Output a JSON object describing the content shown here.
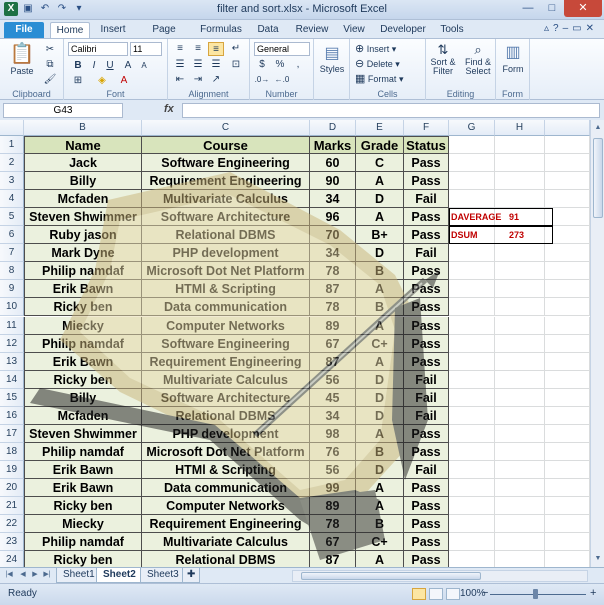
{
  "window": {
    "title": "filter and sort.xlsx  -  Microsoft Excel"
  },
  "ribbon": {
    "tabs": [
      "File",
      "Home",
      "Insert",
      "Page Layout",
      "Formulas",
      "Data",
      "Review",
      "View",
      "Developer",
      "Tools"
    ],
    "active_tab": "Home",
    "clipboard": {
      "paste": "Paste",
      "label": "Clipboard"
    },
    "font": {
      "name": "Calibri",
      "size": "11",
      "label": "Font"
    },
    "alignment": {
      "label": "Alignment"
    },
    "number": {
      "format": "General",
      "currency": "$",
      "percent": "%",
      "comma": ",",
      "label": "Number"
    },
    "styles": {
      "button": "Styles"
    },
    "cells": {
      "insert": "Insert",
      "delete": "Delete",
      "format": "Format",
      "label": "Cells"
    },
    "editing": {
      "sort": "Sort &",
      "sort2": "Filter",
      "find": "Find &",
      "find2": "Select",
      "label": "Editing"
    },
    "form": {
      "button": "Form",
      "label": "Form"
    }
  },
  "formula_bar": {
    "name_box": "G43",
    "fx": "fx",
    "value": ""
  },
  "columns": [
    "B",
    "C",
    "D",
    "E",
    "F",
    "G",
    "H"
  ],
  "rows": [
    "1",
    "2",
    "3",
    "4",
    "5",
    "6",
    "7",
    "8",
    "9",
    "10",
    "11",
    "12",
    "13",
    "14",
    "15",
    "16",
    "17",
    "18",
    "19",
    "20",
    "21",
    "22",
    "23",
    "24"
  ],
  "table": {
    "headers": [
      "Name",
      "Course",
      "Marks",
      "Grade",
      "Status"
    ],
    "records": [
      [
        "Jack",
        "Software Engineering",
        "60",
        "C",
        "Pass"
      ],
      [
        "Billy",
        "Requirement Engineering",
        "90",
        "A",
        "Pass"
      ],
      [
        "Mcfaden",
        "Multivariate Calculus",
        "34",
        "D",
        "Fail"
      ],
      [
        "Steven Shwimmer",
        "Software Architecture",
        "96",
        "A",
        "Pass"
      ],
      [
        "Ruby jason",
        "Relational DBMS",
        "70",
        "B+",
        "Pass"
      ],
      [
        "Mark Dyne",
        "PHP development",
        "34",
        "D",
        "Fail"
      ],
      [
        "Philip namdaf",
        "Microsoft Dot Net Platform",
        "78",
        "B",
        "Pass"
      ],
      [
        "Erik Bawn",
        "HTMl & Scripting",
        "87",
        "A",
        "Pass"
      ],
      [
        "Ricky ben",
        "Data communication",
        "78",
        "B",
        "Pass"
      ],
      [
        "Miecky",
        "Computer Networks",
        "89",
        "A",
        "Pass"
      ],
      [
        "Philip namdaf",
        "Software Engineering",
        "67",
        "C+",
        "Pass"
      ],
      [
        "Erik Bawn",
        "Requirement Engineering",
        "87",
        "A",
        "Pass"
      ],
      [
        "Ricky ben",
        "Multivariate Calculus",
        "56",
        "D",
        "Fail"
      ],
      [
        "Billy",
        "Software Architecture",
        "45",
        "D",
        "Fail"
      ],
      [
        "Mcfaden",
        "Relational DBMS",
        "34",
        "D",
        "Fail"
      ],
      [
        "Steven Shwimmer",
        "PHP development",
        "98",
        "A",
        "Pass"
      ],
      [
        "Philip namdaf",
        "Microsoft Dot Net Platform",
        "76",
        "B",
        "Pass"
      ],
      [
        "Erik Bawn",
        "HTMl & Scripting",
        "56",
        "D",
        "Fail"
      ],
      [
        "Erik Bawn",
        "Data communication",
        "99",
        "A",
        "Pass"
      ],
      [
        "Ricky ben",
        "Computer Networks",
        "89",
        "A",
        "Pass"
      ],
      [
        "Miecky",
        "Requirement Engineering",
        "78",
        "B",
        "Pass"
      ],
      [
        "Philip namdaf",
        "Multivariate Calculus",
        "67",
        "C+",
        "Pass"
      ],
      [
        "Ricky ben",
        "Relational DBMS",
        "87",
        "A",
        "Pass"
      ]
    ]
  },
  "stats": [
    {
      "label": "DAVERAGE",
      "value": "91"
    },
    {
      "label": "DSUM",
      "value": "273"
    }
  ],
  "sheets": {
    "tabs": [
      "Sheet1",
      "Sheet2",
      "Sheet3"
    ],
    "active": "Sheet2"
  },
  "status": {
    "mode": "Ready",
    "zoom": "100%"
  },
  "colors": {
    "table_fill": "#ebf1de",
    "header_fill": "#d8e4bc",
    "stat_text": "#c00000",
    "file_tab": "#2a8dd4"
  }
}
